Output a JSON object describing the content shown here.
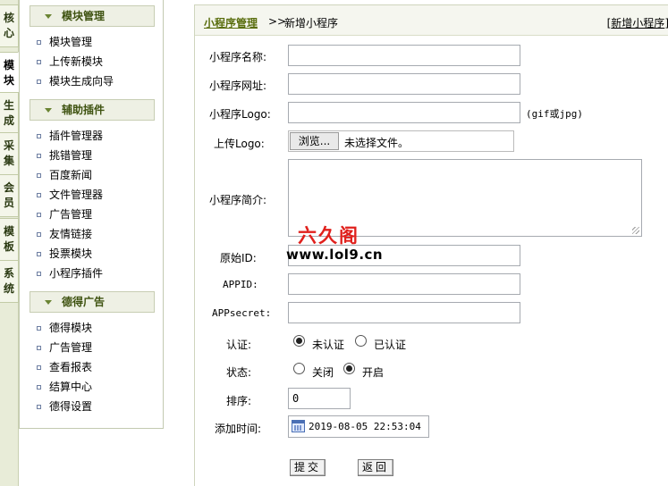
{
  "vtabs": [
    "核心",
    "模块",
    "生成",
    "采集",
    "会员",
    "模板",
    "系统"
  ],
  "sidebar": {
    "groups": [
      {
        "title": "模块管理",
        "items": [
          "模块管理",
          "上传新模块",
          "模块生成向导"
        ]
      },
      {
        "title": "辅助插件",
        "items": [
          "插件管理器",
          "挑错管理",
          "百度新闻",
          "文件管理器",
          "广告管理",
          "友情链接",
          "投票模块",
          "小程序插件"
        ]
      },
      {
        "title": "德得广告",
        "items": [
          "德得模块",
          "广告管理",
          "查看报表",
          "结算中心",
          "德得设置"
        ]
      }
    ]
  },
  "header": {
    "crumb_link": "小程序管理",
    "crumb_sep": ">>",
    "crumb_current": "新增小程序",
    "right_bracket_open": "[",
    "right_link": "新增小程序",
    "right_bracket_close": "]"
  },
  "form": {
    "name_label": "小程序名称:",
    "name_value": "",
    "url_label": "小程序网址:",
    "url_value": "",
    "logo_label": "小程序Logo:",
    "logo_value": "",
    "logo_hint": "(gif或jpg)",
    "upload_label": "上传Logo:",
    "browse_button": "浏览...",
    "no_file_text": "未选择文件。",
    "intro_label": "小程序简介:",
    "origin_label": "原始ID:",
    "appid_label": "APPID:",
    "secret_label": "APPsecret:",
    "verify_label": "认证:",
    "verify_options": [
      "未认证",
      "已认证"
    ],
    "verify_selected": "未认证",
    "status_label": "状态:",
    "status_options": [
      "关闭",
      "开启"
    ],
    "status_selected": "开启",
    "sort_label": "排序:",
    "sort_value": "0",
    "time_label": "添加时间:",
    "time_value": "2019-08-05 22:53:04",
    "submit_button": "提交",
    "back_button": "返回"
  },
  "watermark": {
    "logo_text": "六久阁",
    "url_text": "www.lol9.cn"
  },
  "colors": {
    "accent": "#5a6e0e",
    "sidebar_head_bg": "#eef0e4",
    "watermark_red": "#e0201c"
  }
}
